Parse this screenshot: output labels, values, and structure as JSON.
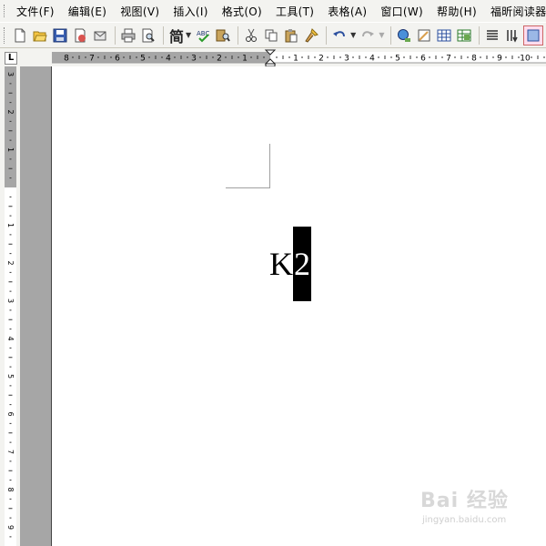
{
  "menu": [
    {
      "label": "文件(F)"
    },
    {
      "label": "编辑(E)"
    },
    {
      "label": "视图(V)"
    },
    {
      "label": "插入(I)"
    },
    {
      "label": "格式(O)"
    },
    {
      "label": "工具(T)"
    },
    {
      "label": "表格(A)"
    },
    {
      "label": "窗口(W)"
    },
    {
      "label": "帮助(H)"
    },
    {
      "label": "福昕阅读器"
    }
  ],
  "toolbar": {
    "jian_label": "简"
  },
  "ruler": {
    "horizontal_left_ticks": [
      "8",
      "7",
      "6",
      "5",
      "4",
      "3",
      "2",
      "1"
    ],
    "horizontal_right_ticks": [
      "1",
      "2",
      "3",
      "4",
      "5",
      "6",
      "7",
      "8",
      "9",
      "10"
    ],
    "vertical_top_ticks": [
      "3",
      "2",
      "1"
    ],
    "vertical_ticks": [
      "1",
      "2",
      "3",
      "4",
      "5",
      "6",
      "7",
      "8",
      "9"
    ],
    "tab_selector": "L"
  },
  "document": {
    "text_plain": "K",
    "text_selected": "2"
  },
  "watermark": {
    "logo": "Bai 经验",
    "url": "jingyan.baidu.com"
  },
  "colors": {
    "chrome": "#f3f3f0",
    "gray_margin": "#a6a6a6",
    "selection": "#000000"
  }
}
